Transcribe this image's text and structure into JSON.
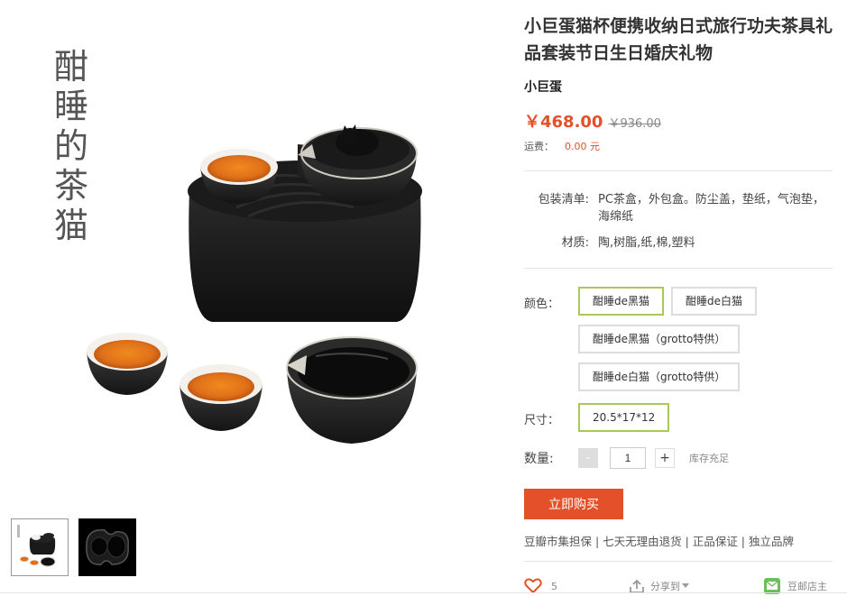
{
  "gallery": {
    "poem": "酣睡的茶猫",
    "main_image": "teaset-black-cat-photo",
    "thumbnails": [
      {
        "name": "thumb-teaset-front",
        "selected": true
      },
      {
        "name": "thumb-teaset-tray",
        "selected": false
      }
    ]
  },
  "product": {
    "title": "小巨蛋猫杯便携收纳日式旅行功夫茶具礼品套装节日生日婚庆礼物",
    "brand": "小巨蛋",
    "price": "￥468.00",
    "original_price": "￥936.00",
    "shipping_label": "运费：",
    "shipping_value": "0.00 元"
  },
  "specs": [
    {
      "label": "包装清单:",
      "value": "PC茶盒，外包盒。防尘盖，垫纸，气泡垫，海绵纸"
    },
    {
      "label": "材质:",
      "value": "陶,树脂,纸,棉,塑料"
    }
  ],
  "color": {
    "label": "颜色：",
    "options": [
      "酣睡de黑猫",
      "酣睡de白猫",
      "酣睡de黑猫（grotto特供）",
      "酣睡de白猫（grotto特供）"
    ],
    "selected": "酣睡de黑猫"
  },
  "size": {
    "label": "尺寸：",
    "options": [
      "20.5*17*12"
    ],
    "selected": "20.5*17*12"
  },
  "quantity": {
    "label": "数量:",
    "minus": "-",
    "value": "1",
    "plus": "+",
    "stock": "库存充足"
  },
  "actions": {
    "buy_label": "立即购买"
  },
  "guarantee": "豆瓣市集担保 | 七天无理由退货 | 正品保证 | 独立品牌",
  "footer": {
    "like_count": "5",
    "share_label": "分享到",
    "owner_label": "豆邮店主"
  },
  "colors": {
    "accent": "#e4502a",
    "selected_border": "#a8c95a",
    "owner_icon": "#6cc05a"
  },
  "icons": [
    "heart-icon",
    "share-icon",
    "caret-down-icon",
    "mail-icon"
  ]
}
